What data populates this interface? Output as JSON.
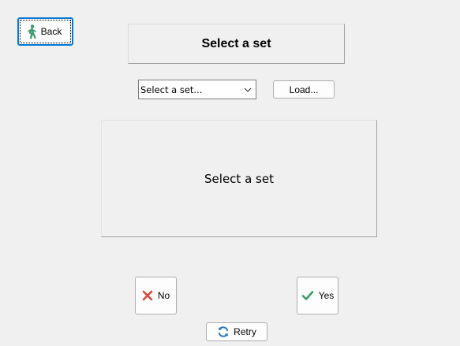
{
  "toolbar": {
    "back_label": "Back",
    "back_icon": "walking-person-icon"
  },
  "header": {
    "title": "Select a set"
  },
  "set_picker": {
    "selected_value": "Select a set...",
    "load_label": "Load..."
  },
  "display": {
    "text": "Select a set"
  },
  "actions": {
    "no_label": "No",
    "yes_label": "Yes",
    "retry_label": "Retry"
  },
  "colors": {
    "back_icon": "#3a9a6a",
    "no_icon": "#d9493b",
    "yes_icon": "#3a9a6a",
    "retry_icon": "#2f78c4",
    "focus_border": "#0078d7"
  }
}
